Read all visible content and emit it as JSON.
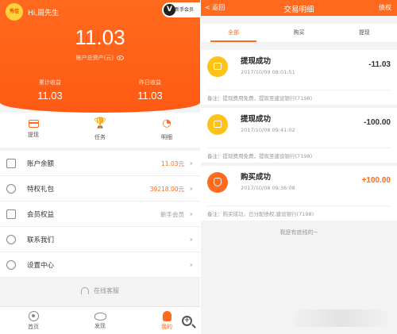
{
  "left": {
    "logo_text": "秀佳",
    "greeting": "Hi,周先生",
    "member_badge": {
      "letter": "V",
      "label": "新手会员"
    },
    "total_assets_value": "11.03",
    "total_assets_label": "账户总资产(元)",
    "stats": [
      {
        "label": "累计收益",
        "value": "11.03"
      },
      {
        "label": "昨日收益",
        "value": "11.03"
      }
    ],
    "quick_actions": [
      {
        "label": "提现",
        "icon": "card-icon"
      },
      {
        "label": "任务",
        "icon": "trophy-icon"
      },
      {
        "label": "明细",
        "icon": "pie-chart-icon"
      }
    ],
    "menu": [
      {
        "label": "账户余额",
        "value": "11.03元",
        "icon": "gift-box-icon"
      },
      {
        "label": "特权礼包",
        "value": "39218.00元",
        "icon": "privilege-icon"
      },
      {
        "label": "会员权益",
        "value": "新手会员",
        "icon": "member-icon"
      },
      {
        "label": "联系我们",
        "value": "",
        "icon": "chat-icon"
      },
      {
        "label": "设置中心",
        "value": "",
        "icon": "settings-icon"
      }
    ],
    "online_service": "在线客服",
    "tabbar": [
      {
        "label": "首页",
        "icon": "home-icon"
      },
      {
        "label": "发现",
        "icon": "eye-icon"
      },
      {
        "label": "我的",
        "icon": "user-icon"
      }
    ],
    "accent": "#ff6a1e"
  },
  "right": {
    "back_label": "< 返回",
    "title": "交易明细",
    "action_label": "债权",
    "tabs": [
      "全部",
      "购买",
      "提现"
    ],
    "records": [
      {
        "title": "提现成功",
        "datetime": "2017/10/09 08:01:51",
        "amount": "-11.03",
        "note": "备注：提现费用免费，提现至建设银行(7198)",
        "icon": "wallet-icon",
        "icon_color": "#ffc21a"
      },
      {
        "title": "提现成功",
        "datetime": "2017/10/08 09:41:02",
        "amount": "-100.00",
        "note": "备注：提现费用免费，提现至建设银行(7198)",
        "icon": "wallet-icon",
        "icon_color": "#ffc21a"
      },
      {
        "title": "购买成功",
        "datetime": "2017/10/08 09:36:08",
        "amount": "+100.00",
        "note": "备注：购买成功，已分配债权,建设银行(7198)",
        "icon": "money-bag-icon",
        "icon_color": "#ff6a1e"
      }
    ],
    "end_text": "我是有底线的~"
  }
}
